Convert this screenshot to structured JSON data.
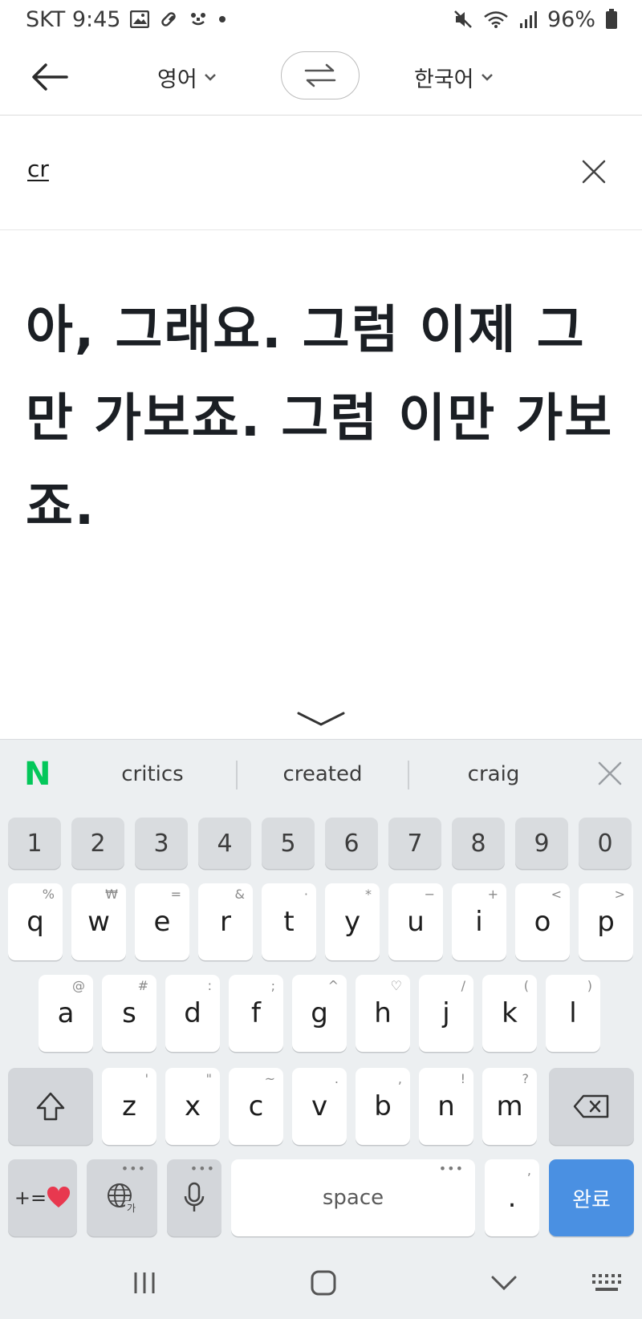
{
  "status_bar": {
    "carrier_time": "SKT 9:45",
    "battery": "96%"
  },
  "top_bar": {
    "source_language": "영어",
    "target_language": "한국어"
  },
  "input": {
    "text": "cr"
  },
  "output": {
    "text": "아, 그래요. 그럼 이제 그만 가보죠. 그럼 이만 가보죠."
  },
  "keyboard": {
    "suggestions": [
      "critics",
      "created",
      "craig"
    ],
    "number_row": [
      "1",
      "2",
      "3",
      "4",
      "5",
      "6",
      "7",
      "8",
      "9",
      "0"
    ],
    "row1": [
      {
        "key": "q",
        "hint": "%"
      },
      {
        "key": "w",
        "hint": "₩"
      },
      {
        "key": "e",
        "hint": "="
      },
      {
        "key": "r",
        "hint": "&"
      },
      {
        "key": "t",
        "hint": "·"
      },
      {
        "key": "y",
        "hint": "*"
      },
      {
        "key": "u",
        "hint": "−"
      },
      {
        "key": "i",
        "hint": "+"
      },
      {
        "key": "o",
        "hint": "<"
      },
      {
        "key": "p",
        "hint": ">"
      }
    ],
    "row2": [
      {
        "key": "a",
        "hint": "@"
      },
      {
        "key": "s",
        "hint": "#"
      },
      {
        "key": "d",
        "hint": ":"
      },
      {
        "key": "f",
        "hint": ";"
      },
      {
        "key": "g",
        "hint": "^"
      },
      {
        "key": "h",
        "hint": "♡"
      },
      {
        "key": "j",
        "hint": "/"
      },
      {
        "key": "k",
        "hint": "("
      },
      {
        "key": "l",
        "hint": ")"
      }
    ],
    "row3": [
      {
        "key": "z",
        "hint": "'"
      },
      {
        "key": "x",
        "hint": "\""
      },
      {
        "key": "c",
        "hint": "~"
      },
      {
        "key": "v",
        "hint": "."
      },
      {
        "key": "b",
        "hint": ","
      },
      {
        "key": "n",
        "hint": "!"
      },
      {
        "key": "m",
        "hint": "?"
      }
    ],
    "symbols_label": "+=",
    "space_label": "space",
    "period_label": ".",
    "period_hint": ",",
    "done_label": "완료",
    "more_dots": "•••"
  },
  "colors": {
    "brand_green": "#03c75a",
    "done_blue": "#4a90e2",
    "heart_red": "#e8384f"
  }
}
